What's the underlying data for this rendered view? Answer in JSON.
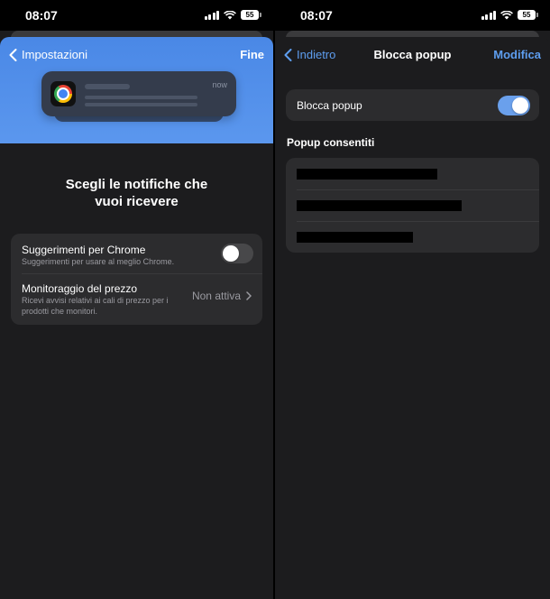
{
  "left": {
    "status": {
      "time": "08:07",
      "battery": "55"
    },
    "nav": {
      "back_label": "Impostazioni",
      "done_label": "Fine"
    },
    "preview": {
      "time": "now"
    },
    "headline": "Scegli le notifiche che vuoi ricevere",
    "settings": [
      {
        "title": "Suggerimenti per Chrome",
        "subtitle": "Suggerimenti per usare al meglio Chrome.",
        "toggle": "off"
      },
      {
        "title": "Monitoraggio del prezzo",
        "subtitle": "Ricevi avvisi relativi ai cali di prezzo per i prodotti che monitori.",
        "value": "Non attiva"
      }
    ]
  },
  "right": {
    "status": {
      "time": "08:07",
      "battery": "55"
    },
    "nav": {
      "back_label": "Indietro",
      "title": "Blocca popup",
      "edit_label": "Modifica"
    },
    "block_popup": {
      "label": "Blocca popup",
      "toggle": "on"
    },
    "allowed_header": "Popup consentiti",
    "allowed_items": [
      "redacted",
      "redacted",
      "redacted"
    ]
  },
  "colors": {
    "accent_blue": "#5e9ef0",
    "hero_blue": "#4a88e6",
    "background": "#1c1c1e",
    "cell": "#2c2c2e",
    "toggle_on": "#6aa0ec",
    "toggle_off": "#48484a"
  },
  "icons": [
    "chevron-left-icon",
    "chevron-right-icon",
    "signal-icon",
    "wifi-icon",
    "battery-icon",
    "chrome-icon"
  ]
}
